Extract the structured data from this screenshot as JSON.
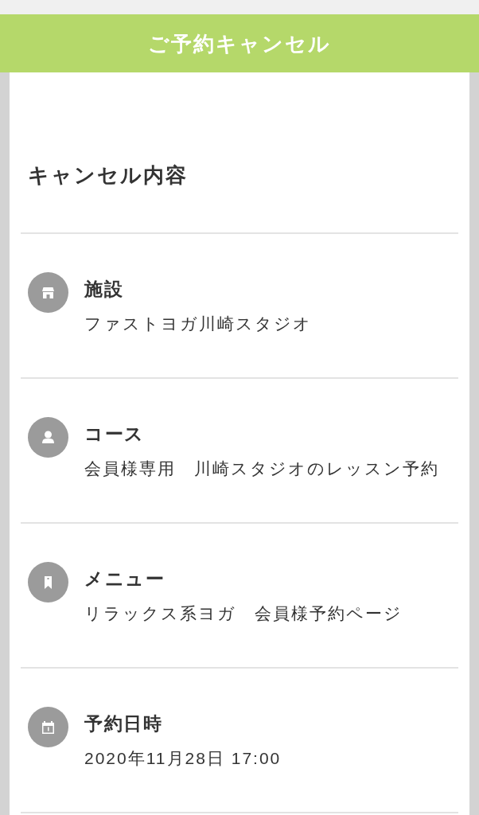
{
  "header": {
    "title": "ご予約キャンセル"
  },
  "section": {
    "title": "キャンセル内容"
  },
  "details": [
    {
      "kind": "store",
      "label": "施設",
      "value": "ファストヨガ川崎スタジオ"
    },
    {
      "kind": "person",
      "label": "コース",
      "value": "会員様専用　川崎スタジオのレッスン予約"
    },
    {
      "kind": "bookmark",
      "label": "メニュー",
      "value": "リラックス系ヨガ　会員様予約ページ"
    },
    {
      "kind": "calendar",
      "label": "予約日時",
      "value": "2020年11月28日 17:00"
    }
  ]
}
